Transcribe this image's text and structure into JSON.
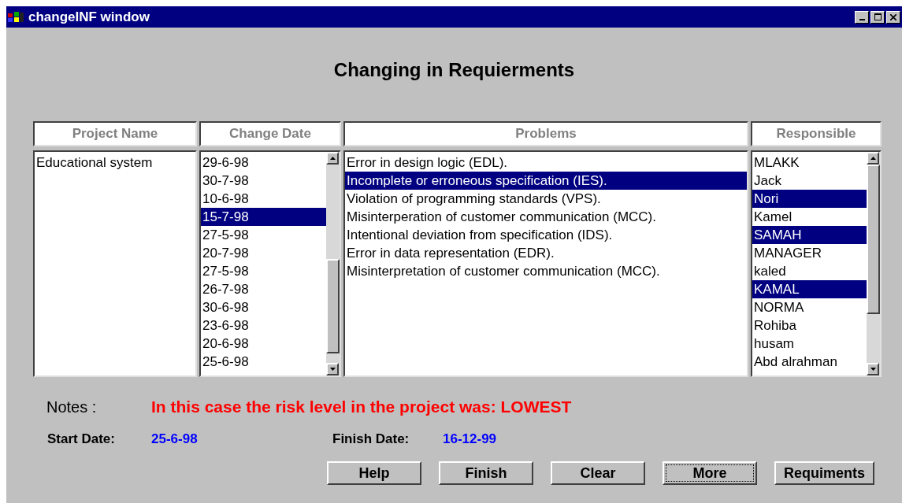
{
  "window": {
    "title": "changeINF window"
  },
  "heading": "Changing in Requierments",
  "columns": [
    {
      "header": "Project Name",
      "kind": "plain",
      "items": [
        {
          "text": "Educational system",
          "selected": false
        }
      ]
    },
    {
      "header": "Change Date",
      "kind": "scroll",
      "items": [
        {
          "text": "29-6-98",
          "selected": false
        },
        {
          "text": "30-7-98",
          "selected": false
        },
        {
          "text": "10-6-98",
          "selected": false
        },
        {
          "text": "15-7-98",
          "selected": true
        },
        {
          "text": "27-5-98",
          "selected": false
        },
        {
          "text": "20-7-98",
          "selected": false
        },
        {
          "text": "27-5-98",
          "selected": false
        },
        {
          "text": "26-7-98",
          "selected": false
        },
        {
          "text": "30-6-98",
          "selected": false
        },
        {
          "text": "23-6-98",
          "selected": false
        },
        {
          "text": "20-6-98",
          "selected": false
        },
        {
          "text": "25-6-98",
          "selected": false
        }
      ]
    },
    {
      "header": "Problems",
      "kind": "plain",
      "items": [
        {
          "text": "Error in design logic (EDL).",
          "selected": false
        },
        {
          "text": "Incomplete or erroneous specification (IES).",
          "selected": true
        },
        {
          "text": "Violation of programming standards (VPS).",
          "selected": false
        },
        {
          "text": "Misinterperation of customer communication (MCC).",
          "selected": false
        },
        {
          "text": "Intentional deviation from specification (IDS).",
          "selected": false
        },
        {
          "text": "Error in data representation (EDR).",
          "selected": false
        },
        {
          "text": "Misinterpretation of customer communication (MCC).",
          "selected": false
        }
      ]
    },
    {
      "header": "Responsible",
      "kind": "scroll",
      "items": [
        {
          "text": "MLAKK",
          "selected": false
        },
        {
          "text": "Jack",
          "selected": false
        },
        {
          "text": "Nori",
          "selected": true
        },
        {
          "text": "Kamel",
          "selected": false
        },
        {
          "text": "SAMAH",
          "selected": true
        },
        {
          "text": "MANAGER",
          "selected": false
        },
        {
          "text": "kaled",
          "selected": false
        },
        {
          "text": "KAMAL",
          "selected": true
        },
        {
          "text": "NORMA",
          "selected": false
        },
        {
          "text": "Rohiba",
          "selected": false
        },
        {
          "text": "husam",
          "selected": false
        },
        {
          "text": "Abd alrahman",
          "selected": false
        }
      ]
    }
  ],
  "notes": {
    "label": "Notes :",
    "text": "In this case the risk level in the project was: LOWEST"
  },
  "start_date": {
    "label": "Start Date:",
    "value": "25-6-98"
  },
  "finish_date": {
    "label": "Finish Date:",
    "value": "16-12-99"
  },
  "buttons": [
    {
      "label": "Help",
      "focused": false
    },
    {
      "label": "Finish",
      "focused": false
    },
    {
      "label": "Clear",
      "focused": false
    },
    {
      "label": "More",
      "focused": true
    },
    {
      "label": "Requiments",
      "focused": false
    }
  ]
}
